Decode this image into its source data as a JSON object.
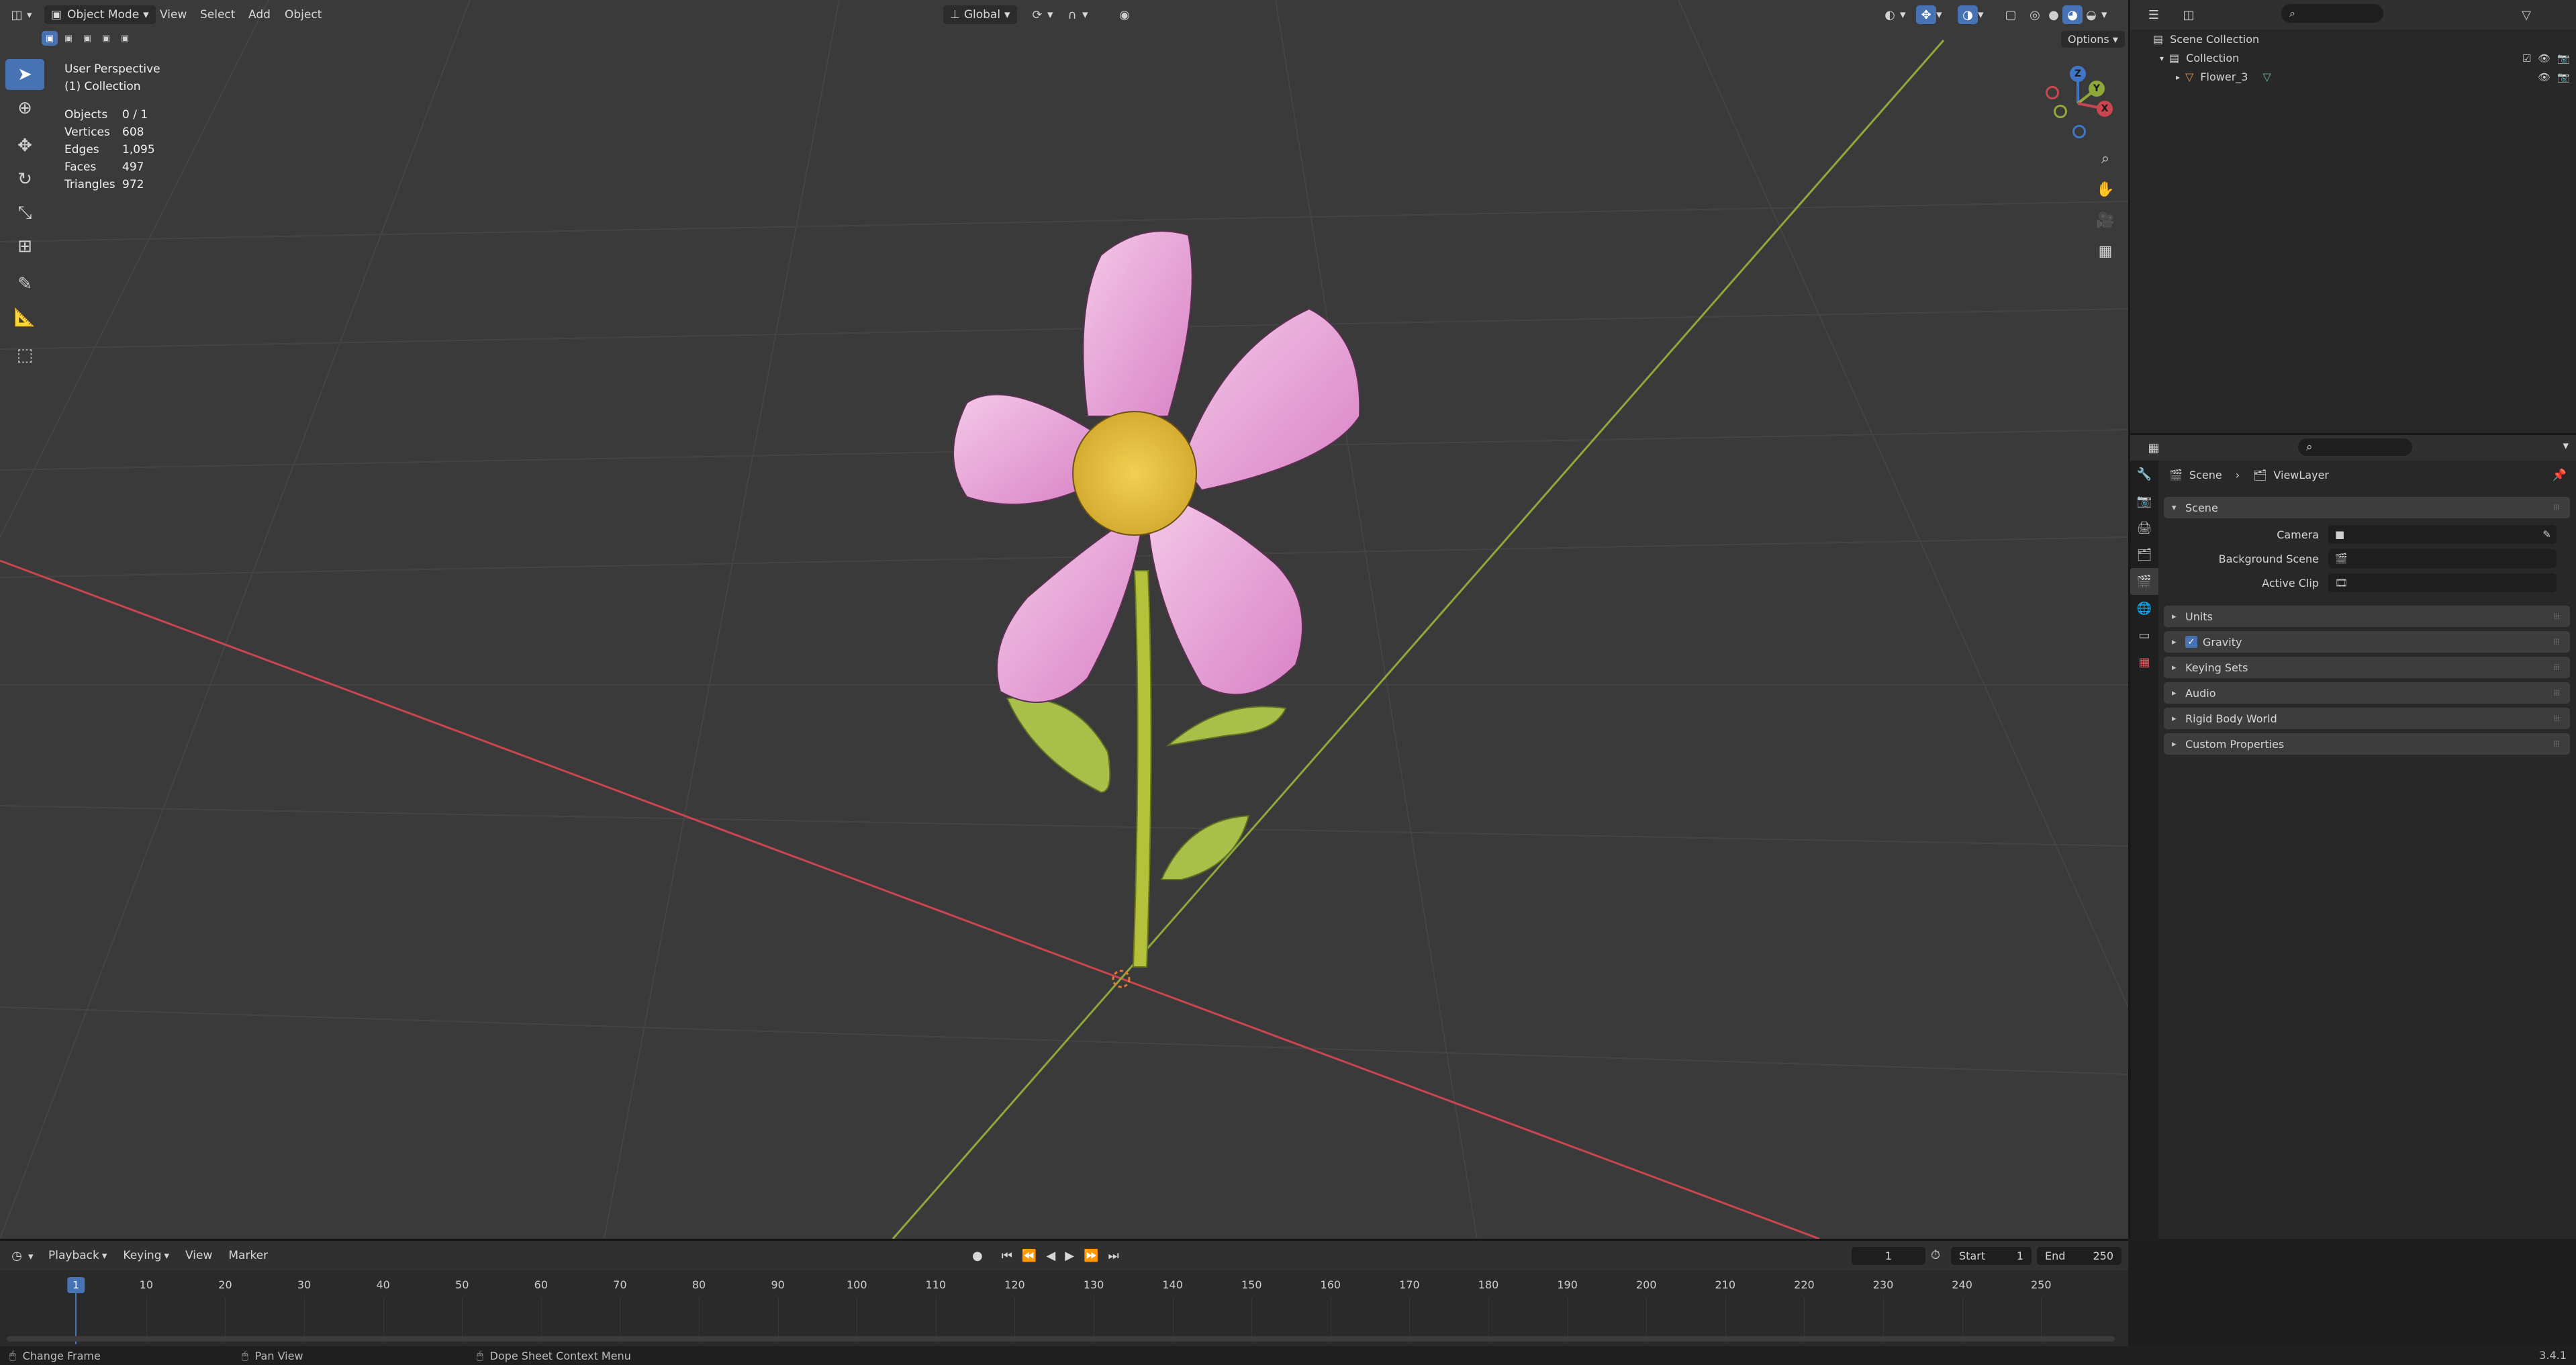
{
  "colors": {
    "accent": "#4772b3",
    "viewport_bg": "#3a3a3a",
    "panel_bg": "#282828",
    "x_axis": "#c9454f",
    "y_axis": "#8ea83a",
    "petal": "#e8a0d8",
    "flower_center": "#e8c23a",
    "stem": "#b3c23a"
  },
  "viewport_header": {
    "mode_label": "Object Mode",
    "menus": [
      "View",
      "Select",
      "Add",
      "Object"
    ],
    "transform_orientation": "Global",
    "options_label": "Options"
  },
  "overlay": {
    "perspective": "User Perspective",
    "collection": "(1) Collection"
  },
  "stats": [
    {
      "label": "Objects",
      "value": "0 / 1"
    },
    {
      "label": "Vertices",
      "value": "608"
    },
    {
      "label": "Edges",
      "value": "1,095"
    },
    {
      "label": "Faces",
      "value": "497"
    },
    {
      "label": "Triangles",
      "value": "972"
    }
  ],
  "gizmo": {
    "z": "Z",
    "y": "Y",
    "x": "X"
  },
  "outliner": {
    "scene_collection": "Scene Collection",
    "collection": "Collection",
    "object": "Flower_3"
  },
  "properties": {
    "breadcrumb_scene": "Scene",
    "breadcrumb_viewlayer": "ViewLayer",
    "panel_scene": "Scene",
    "camera_label": "Camera",
    "background_scene_label": "Background Scene",
    "active_clip_label": "Active Clip",
    "panels": [
      "Units",
      "Gravity",
      "Keying Sets",
      "Audio",
      "Rigid Body World",
      "Custom Properties"
    ]
  },
  "timeline": {
    "menus": [
      "Playback",
      "Keying",
      "View",
      "Marker"
    ],
    "current_frame": "1",
    "start_label": "Start",
    "start_value": "1",
    "end_label": "End",
    "end_value": "250",
    "ruler_ticks": [
      "10",
      "20",
      "30",
      "40",
      "50",
      "60",
      "70",
      "80",
      "90",
      "100",
      "110",
      "120",
      "130",
      "140",
      "150",
      "160",
      "170",
      "180",
      "190",
      "200",
      "210",
      "220",
      "230",
      "240",
      "250"
    ],
    "playhead_label": "1"
  },
  "statusbar": {
    "left": "Change Frame",
    "middle": "Pan View",
    "right": "Dope Sheet Context Menu",
    "version": "3.4.1"
  }
}
